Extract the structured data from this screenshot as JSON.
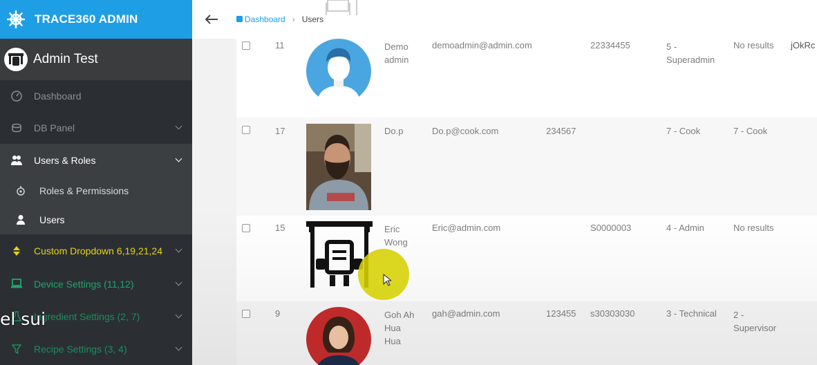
{
  "app": {
    "brand": "TRACE360 ADMIN"
  },
  "user": {
    "name": "Admin Test"
  },
  "sidebar": {
    "items": [
      {
        "label": "Dashboard",
        "icon": "gauge-icon"
      },
      {
        "label": "DB Panel",
        "icon": "database-icon"
      },
      {
        "label": "Users & Roles",
        "icon": "users-icon"
      },
      {
        "label": "Roles & Permissions",
        "icon": "cog-icon"
      },
      {
        "label": "Users",
        "icon": "user-icon"
      },
      {
        "label": "Custom Dropdown 6,19,21,24",
        "icon": "sort-icon"
      },
      {
        "label": "Device Settings (11,12)",
        "icon": "laptop-icon"
      },
      {
        "label": "Ingredient Settings (2, 7)",
        "icon": "flask-icon"
      },
      {
        "label": "Recipe Settings (3, 4)",
        "icon": "filter-icon"
      }
    ]
  },
  "breadcrumb": {
    "dashboard": "Dashboard",
    "current": "Users"
  },
  "table": {
    "rows": [
      {
        "id": "11",
        "name": "Demo admin",
        "email": "demoadmin@admin.com",
        "phone": "",
        "code": "22334455",
        "role": "5 - Superadmin",
        "supervisor": "No results",
        "extra": "jOkRc"
      },
      {
        "id": "17",
        "name": "Do.p",
        "email": "Do.p@cook.com",
        "phone": "234567",
        "code": "",
        "role": "7 - Cook",
        "supervisor": "7 - Cook",
        "extra": ""
      },
      {
        "id": "15",
        "name": "Eric Wong",
        "email": "Eric@admin.com",
        "phone": "",
        "code": "S0000003",
        "role": "4 - Admin",
        "supervisor": "No results",
        "extra": ""
      },
      {
        "id": "9",
        "name": "Goh Ah Hua Hua",
        "email": "gah@admin.com",
        "phone": "123455",
        "code": "s30303030",
        "role": "3 - Technical",
        "supervisor": "2 - Supervisor",
        "extra": ""
      }
    ]
  },
  "overlay": {
    "caption": "el sui"
  },
  "colors": {
    "brand": "#1e9ee5",
    "sidebar": "#2b2f33",
    "yellow": "#e3d21a",
    "green": "#22a46e"
  }
}
